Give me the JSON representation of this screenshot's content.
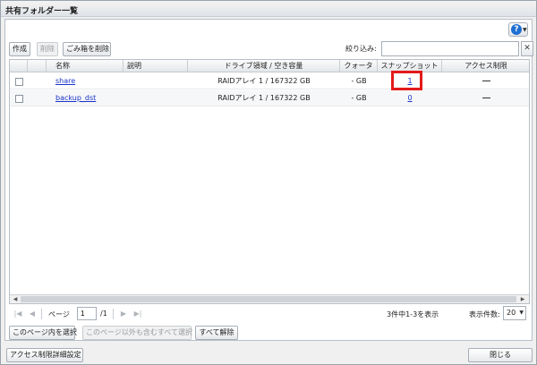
{
  "window": {
    "title": "共有フォルダー一覧"
  },
  "toolbar": {
    "create_label": "作成",
    "delete_label": "削除",
    "empty_trash_label": "ごみ箱を削除",
    "filter_label": "絞り込み:",
    "filter_value": "",
    "clear_glyph": "✕"
  },
  "help": {
    "glyph": "?",
    "caret": "▼"
  },
  "table": {
    "headers": {
      "name": "名称",
      "description": "説明",
      "drive": "ドライブ領域 / 空き容量",
      "quota": "クォータ",
      "snapshot": "スナップショット",
      "access": "アクセス制限"
    },
    "rows": [
      {
        "name": "share",
        "description": "",
        "drive": "RAIDアレイ 1 / 167322 GB",
        "quota": "- GB",
        "snapshot": "1"
      },
      {
        "name": "backup_dst",
        "description": "",
        "drive": "RAIDアレイ 1 / 167322 GB",
        "quota": "- GB",
        "snapshot": "0"
      }
    ]
  },
  "pager": {
    "page_label": "ページ",
    "page_value": "1",
    "page_total": "/1",
    "summary": "3件中1-3を表示",
    "per_page_label": "表示件数:",
    "per_page_value": "20"
  },
  "selection": {
    "select_page_label": "このページ内を選択",
    "select_all_label": "このページ以外も含むすべて選択",
    "deselect_label": "すべて解除"
  },
  "footer": {
    "access_detail_label": "アクセス制限詳細設定",
    "close_label": "閉じる"
  },
  "colors": {
    "highlight": "#e21b1b",
    "link": "#1a34c8",
    "help": "#1f6fd1"
  }
}
